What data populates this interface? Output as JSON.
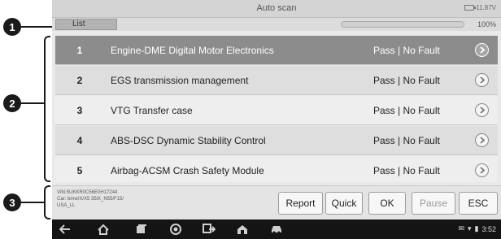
{
  "callouts": [
    "1",
    "2",
    "3"
  ],
  "titlebar": {
    "title": "Auto scan",
    "battery_text": "11.87V"
  },
  "listbar": {
    "tab_label": "List",
    "progress_percent": 100,
    "progress_text": "100%"
  },
  "rows": [
    {
      "num": "1",
      "name": "Engine-DME Digital Motor Electronics",
      "status": "Pass | No Fault",
      "selected": true
    },
    {
      "num": "2",
      "name": "EGS transmission management",
      "status": "Pass | No Fault"
    },
    {
      "num": "3",
      "name": "VTG Transfer case",
      "status": "Pass | No Fault"
    },
    {
      "num": "4",
      "name": "ABS-DSC Dynamic Stability Control",
      "status": "Pass | No Fault"
    },
    {
      "num": "5",
      "name": "Airbag-ACSM Crash Safety Module",
      "status": "Pass | No Fault"
    }
  ],
  "vehicle_info": {
    "vin": "VIN:5UKKR0C56E0H17244",
    "car": "Car: bmw/X/X5 35iX_N55/F15/",
    "region": "USA_LL"
  },
  "buttons": {
    "report": "Report",
    "quick": "Quick",
    "ok": "OK",
    "pause": "Pause",
    "esc": "ESC"
  },
  "navbar": {
    "time": "3:52"
  },
  "colors": {
    "selected_row": "#8c8c8c",
    "nav_bg": "#141414"
  }
}
